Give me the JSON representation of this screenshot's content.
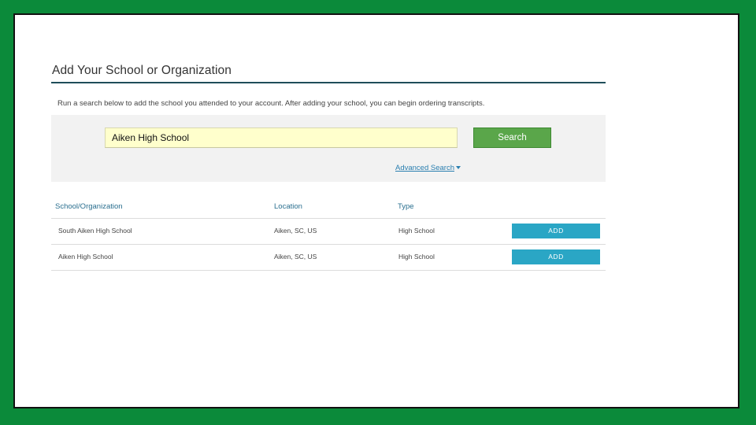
{
  "page": {
    "title": "Add Your School or Organization",
    "intro": "Run a search below to add the school you attended to your account. After adding your school, you can begin ordering transcripts."
  },
  "search": {
    "value": "Aiken High School",
    "button_label": "Search",
    "advanced_label": "Advanced Search"
  },
  "table": {
    "headers": [
      "School/Organization",
      "Location",
      "Type"
    ],
    "rows": [
      {
        "name": "South Aiken High School",
        "location": "Aiken, SC, US",
        "type": "High School",
        "action": "ADD"
      },
      {
        "name": "Aiken High School",
        "location": "Aiken, SC, US",
        "type": "High School",
        "action": "ADD"
      }
    ]
  },
  "colors": {
    "frame": "#0b8a3a",
    "search_button": "#5aa64a",
    "add_button": "#2aa6c5",
    "link": "#2a7fb0",
    "input_bg": "#ffffcc"
  }
}
